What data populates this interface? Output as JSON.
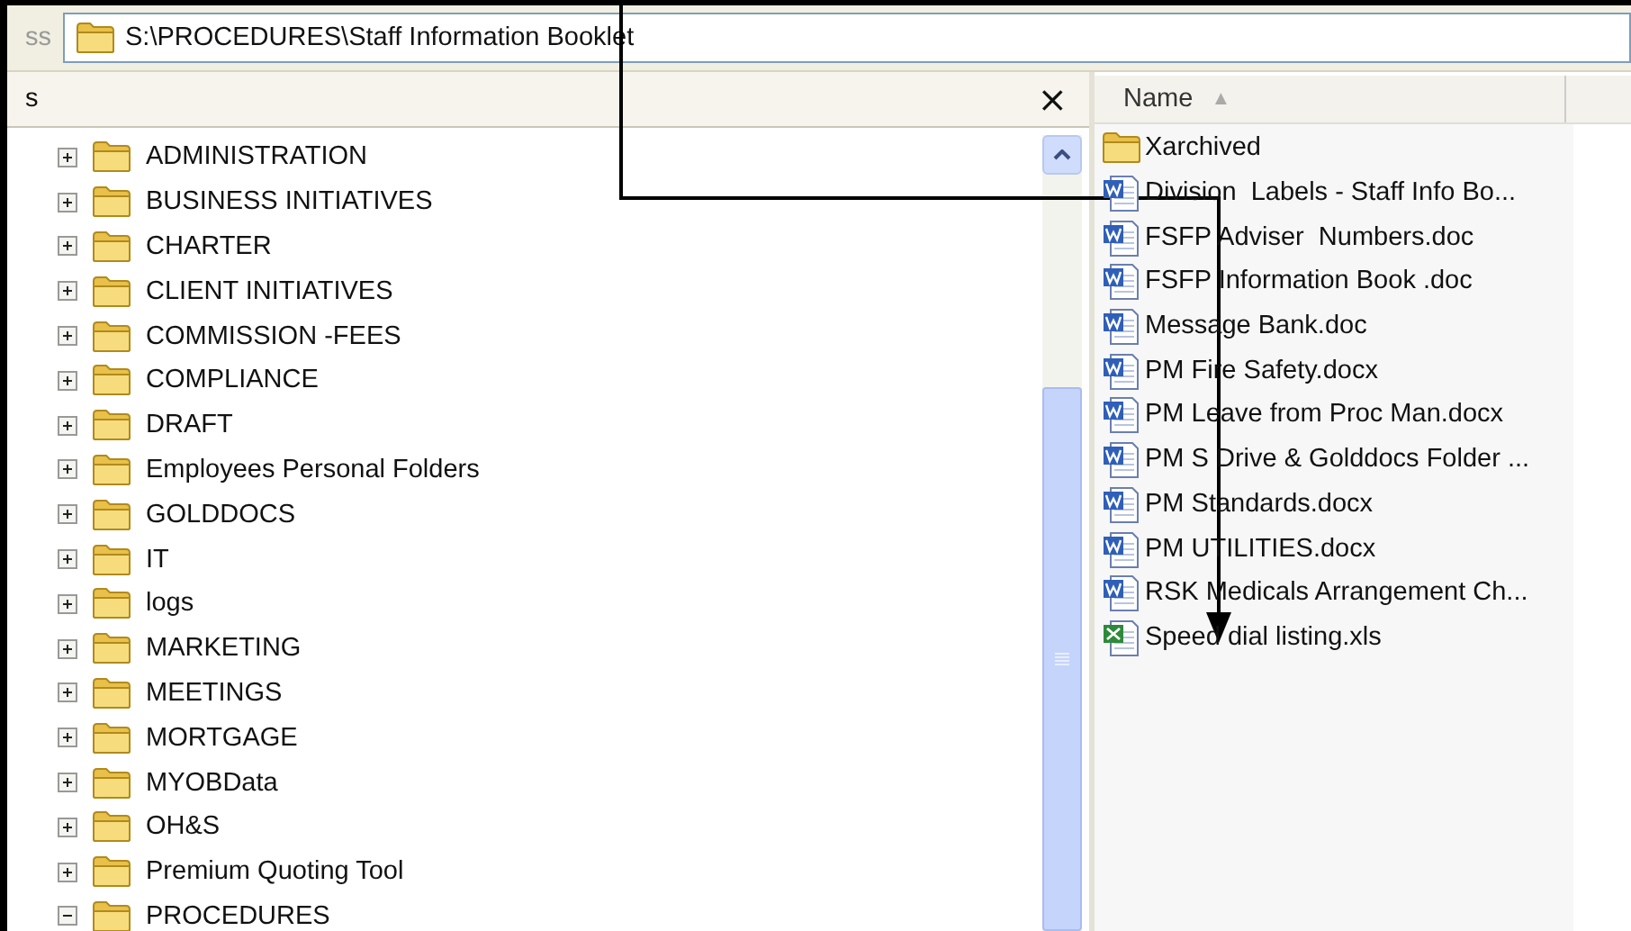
{
  "address_bar": {
    "label": "ss",
    "path": "S:\\PROCEDURES\\Staff Information Booklet"
  },
  "folders_pane": {
    "title": "s",
    "close": "×",
    "tree": [
      {
        "name": "ADMINISTRATION",
        "expanded": false
      },
      {
        "name": "BUSINESS INITIATIVES",
        "expanded": false
      },
      {
        "name": "CHARTER",
        "expanded": false
      },
      {
        "name": "CLIENT INITIATIVES",
        "expanded": false
      },
      {
        "name": "COMMISSION -FEES",
        "expanded": false
      },
      {
        "name": "COMPLIANCE",
        "expanded": false
      },
      {
        "name": "DRAFT",
        "expanded": false
      },
      {
        "name": "Employees Personal Folders",
        "expanded": false
      },
      {
        "name": "GOLDDOCS",
        "expanded": false
      },
      {
        "name": "IT",
        "expanded": false
      },
      {
        "name": "logs",
        "expanded": false
      },
      {
        "name": "MARKETING",
        "expanded": false
      },
      {
        "name": "MEETINGS",
        "expanded": false
      },
      {
        "name": "MORTGAGE",
        "expanded": false
      },
      {
        "name": "MYOBData",
        "expanded": false
      },
      {
        "name": "OH&S",
        "expanded": false
      },
      {
        "name": "Premium Quoting Tool",
        "expanded": false
      },
      {
        "name": "PROCEDURES",
        "expanded": true
      }
    ]
  },
  "file_list": {
    "columns": [
      {
        "label": "Name",
        "sort": "▲"
      }
    ],
    "files": [
      {
        "name": "Xarchived",
        "kind": "folder"
      },
      {
        "name": "Division  Labels - Staff Info Bo...",
        "kind": "word"
      },
      {
        "name": "FSFP Adviser  Numbers.doc",
        "kind": "word"
      },
      {
        "name": "FSFP Information Book .doc",
        "kind": "word"
      },
      {
        "name": "Message Bank.doc",
        "kind": "word"
      },
      {
        "name": "PM Fire Safety.docx",
        "kind": "word"
      },
      {
        "name": "PM Leave from Proc Man.docx",
        "kind": "word"
      },
      {
        "name": "PM S Drive & Golddocs Folder ...",
        "kind": "word"
      },
      {
        "name": "PM Standards.docx",
        "kind": "word"
      },
      {
        "name": "PM UTILITIES.docx",
        "kind": "word"
      },
      {
        "name": "RSK Medicals Arrangement Ch...",
        "kind": "word"
      },
      {
        "name": "Speed dial listing.xls",
        "kind": "excel"
      }
    ]
  }
}
